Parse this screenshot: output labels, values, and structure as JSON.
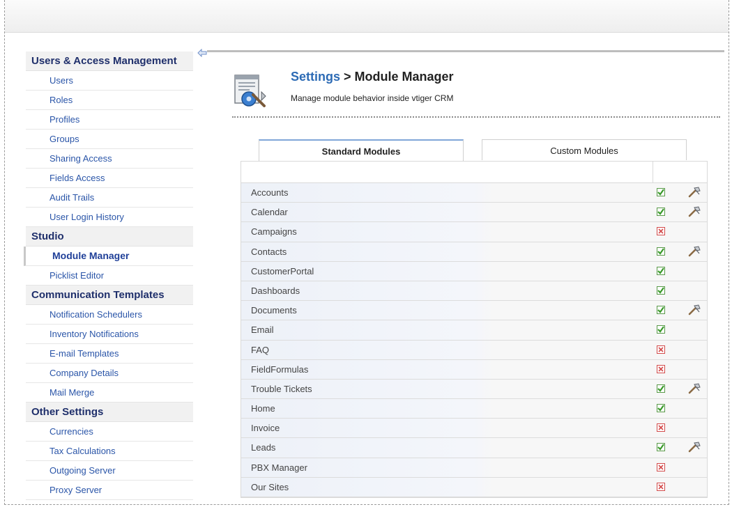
{
  "sidebar": {
    "sections": [
      {
        "heading": "Users & Access Management",
        "items": [
          "Users",
          "Roles",
          "Profiles",
          "Groups",
          "Sharing Access",
          "Fields Access",
          "Audit Trails",
          "User Login History"
        ]
      },
      {
        "heading": "Studio",
        "items": [
          "Module Manager",
          "Picklist Editor"
        ],
        "active": "Module Manager"
      },
      {
        "heading": "Communication Templates",
        "items": [
          "Notification Schedulers",
          "Inventory Notifications",
          "E-mail Templates",
          "Company Details",
          "Mail Merge"
        ]
      },
      {
        "heading": "Other Settings",
        "items": [
          "Currencies",
          "Tax Calculations",
          "Outgoing Server",
          "Proxy Server"
        ]
      }
    ]
  },
  "header": {
    "crumb": "Settings",
    "separator": " > ",
    "title": "Module Manager",
    "subtitle": "Manage module behavior inside vtiger CRM"
  },
  "tabs": [
    {
      "label": "Standard Modules",
      "active": true
    },
    {
      "label": "Custom Modules",
      "active": false
    }
  ],
  "modules": [
    {
      "name": "Accounts",
      "enabled": true,
      "settings": true
    },
    {
      "name": "Calendar",
      "enabled": true,
      "settings": true
    },
    {
      "name": "Campaigns",
      "enabled": false,
      "settings": false
    },
    {
      "name": "Contacts",
      "enabled": true,
      "settings": true
    },
    {
      "name": "CustomerPortal",
      "enabled": true,
      "settings": false
    },
    {
      "name": "Dashboards",
      "enabled": true,
      "settings": false
    },
    {
      "name": "Documents",
      "enabled": true,
      "settings": true
    },
    {
      "name": "Email",
      "enabled": true,
      "settings": false
    },
    {
      "name": "FAQ",
      "enabled": false,
      "settings": false
    },
    {
      "name": "FieldFormulas",
      "enabled": false,
      "settings": false
    },
    {
      "name": "Trouble Tickets",
      "enabled": true,
      "settings": true
    },
    {
      "name": "Home",
      "enabled": true,
      "settings": false
    },
    {
      "name": "Invoice",
      "enabled": false,
      "settings": false
    },
    {
      "name": "Leads",
      "enabled": true,
      "settings": true
    },
    {
      "name": "PBX Manager",
      "enabled": false,
      "settings": false
    },
    {
      "name": "Our Sites",
      "enabled": false,
      "settings": false
    }
  ],
  "colors": {
    "accent": "#2d6bb5",
    "enabled": "#3a9a2a",
    "disabled": "#d34b4b",
    "heading": "#1f2f6b"
  },
  "icons": {
    "collapse": "collapse-left-icon",
    "tool": "hammer-icon",
    "settings": "settings-module-icon"
  }
}
